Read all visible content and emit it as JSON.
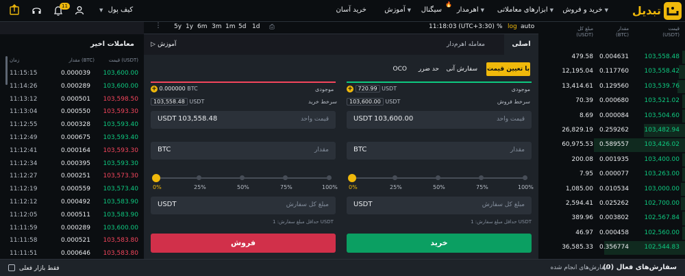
{
  "header": {
    "logo_text": "تبدیل",
    "nav": [
      {
        "label": "خرید و فروش",
        "caret": true
      },
      {
        "label": "ابزارهای معاملاتی",
        "caret": true
      },
      {
        "label": "اهرمدار",
        "caret": true
      },
      {
        "label": "سیگنال",
        "caret": false
      },
      {
        "label": "آموزش",
        "caret": true
      },
      {
        "label": "خرید آسان",
        "caret": false
      }
    ],
    "wallet_label": "کیف پول",
    "notification_count": "11"
  },
  "orderbook": {
    "col_total": "مبلغ کل\n(USDT)",
    "col_amount": "مقدار\n(BTC)",
    "col_price": "قیمت\n(USDT)",
    "rows": [
      {
        "total": "479.58",
        "amount": "0.004631",
        "price": "103,558.48",
        "depth": 0.02
      },
      {
        "total": "12,195.04",
        "amount": "0.117760",
        "price": "103,558.42",
        "depth": 0.04
      },
      {
        "total": "13,414.61",
        "amount": "0.129560",
        "price": "103,539.76",
        "depth": 0.05
      },
      {
        "total": "70.39",
        "amount": "0.000680",
        "price": "103,521.02",
        "depth": 0.02
      },
      {
        "total": "8.69",
        "amount": "0.000084",
        "price": "103,504.60",
        "depth": 0.02
      },
      {
        "total": "26,829.19",
        "amount": "0.259262",
        "price": "103,482.94",
        "depth": 0.28
      },
      {
        "total": "60,975.53",
        "amount": "0.589557",
        "price": "103,426.02",
        "depth": 0.62
      },
      {
        "total": "200.08",
        "amount": "0.001935",
        "price": "103,400.00",
        "depth": 0.02
      },
      {
        "total": "7.95",
        "amount": "0.000077",
        "price": "103,263.00",
        "depth": 0.02
      },
      {
        "total": "1,085.00",
        "amount": "0.010534",
        "price": "103,000.00",
        "depth": 0.03
      },
      {
        "total": "2,594.41",
        "amount": "0.025262",
        "price": "102,700.00",
        "depth": 0.03
      },
      {
        "total": "389.96",
        "amount": "0.003802",
        "price": "102,567.84",
        "depth": 0.02
      },
      {
        "total": "46.97",
        "amount": "0.000458",
        "price": "102,560.00",
        "depth": 0.02
      },
      {
        "total": "36,585.33",
        "amount": "0.356774",
        "price": "102,544.83",
        "depth": 0.55
      }
    ]
  },
  "chartbar": {
    "modes": [
      "auto",
      "log",
      "%"
    ],
    "clock": "11:18:03 (UTC+3:30)",
    "ranges": [
      "1d",
      "5d",
      "1m",
      "3m",
      "6m",
      "1y",
      "5y"
    ]
  },
  "form": {
    "tab_main": "اصلی",
    "tab_margin": "معامله اهرم‌دار",
    "tutorial": "آموزش",
    "order_types": [
      "با تعیین قیمت",
      "سفارش آنی",
      "حد ضرر",
      "OCO"
    ],
    "buy": {
      "balance_label": "موجودی",
      "balance_value": "720.99",
      "balance_unit": "USDT",
      "ref_label": "سرخط فروش",
      "ref_value": "103,600.00",
      "ref_unit": "USDT",
      "price_label": "قیمت واحد",
      "price_value": "103,600.00",
      "price_unit": "USDT",
      "amount_label": "مقدار",
      "amount_unit": "BTC",
      "total_label": "مبلغ کل سفارش",
      "total_unit": "USDT",
      "min_note": "حداقل مبلغ سفارش: 1 USDT",
      "button": "خرید",
      "slider_value": 0
    },
    "sell": {
      "balance_label": "موجودی",
      "balance_value": "0.000000",
      "balance_unit": "BTC",
      "ref_label": "سرخط خرید",
      "ref_value": "103,558.48",
      "ref_unit": "USDT",
      "price_label": "قیمت واحد",
      "price_value": "103,558.48",
      "price_unit": "USDT",
      "amount_label": "مقدار",
      "amount_unit": "BTC",
      "total_label": "مبلغ کل سفارش",
      "total_unit": "USDT",
      "min_note": "حداقل مبلغ سفارش: 1 USDT",
      "button": "فروش",
      "slider_value": 0
    },
    "slider_marks": [
      "0%",
      "25%",
      "50%",
      "75%",
      "100%"
    ]
  },
  "trades": {
    "title": "معاملات اخیر",
    "col_price": "قیمت (USDT)",
    "col_amount": "مقدار (BTC)",
    "col_time": "زمان",
    "rows": [
      {
        "time": "11:15:15",
        "amount": "0.000039",
        "price": "103,600.00",
        "side": "buy"
      },
      {
        "time": "11:14:26",
        "amount": "0.000289",
        "price": "103,600.00",
        "side": "buy"
      },
      {
        "time": "11:13:12",
        "amount": "0.000501",
        "price": "103,598.50",
        "side": "sell"
      },
      {
        "time": "11:13:04",
        "amount": "0.000550",
        "price": "103,593.30",
        "side": "sell"
      },
      {
        "time": "11:12:55",
        "amount": "0.000328",
        "price": "103,593.40",
        "side": "buy"
      },
      {
        "time": "11:12:49",
        "amount": "0.000675",
        "price": "103,593.40",
        "side": "buy"
      },
      {
        "time": "11:12:41",
        "amount": "0.000164",
        "price": "103,593.30",
        "side": "sell"
      },
      {
        "time": "11:12:34",
        "amount": "0.000395",
        "price": "103,593.30",
        "side": "buy"
      },
      {
        "time": "11:12:27",
        "amount": "0.000251",
        "price": "103,573.30",
        "side": "sell"
      },
      {
        "time": "11:12:19",
        "amount": "0.000559",
        "price": "103,573.40",
        "side": "buy"
      },
      {
        "time": "11:12:12",
        "amount": "0.000492",
        "price": "103,583.90",
        "side": "buy"
      },
      {
        "time": "11:12:05",
        "amount": "0.000511",
        "price": "103,583.90",
        "side": "buy"
      },
      {
        "time": "11:11:59",
        "amount": "0.000289",
        "price": "103,600.00",
        "side": "buy"
      },
      {
        "time": "11:11:58",
        "amount": "0.000521",
        "price": "103,583.80",
        "side": "sell"
      },
      {
        "time": "11:11:51",
        "amount": "0.000646",
        "price": "103,583.80",
        "side": "sell"
      }
    ]
  },
  "bottom": {
    "active_orders": "سفارش‌های فعال",
    "active_count": "(0)",
    "done_orders": "سفارش‌های انجام شده",
    "current_market_only": "فقط بازار فعلی"
  },
  "colors": {
    "accent": "#f0b90b",
    "buy": "#0ecb81",
    "sell": "#f6465d",
    "buy_button": "#0b9f62",
    "sell_button": "#d1304a"
  }
}
